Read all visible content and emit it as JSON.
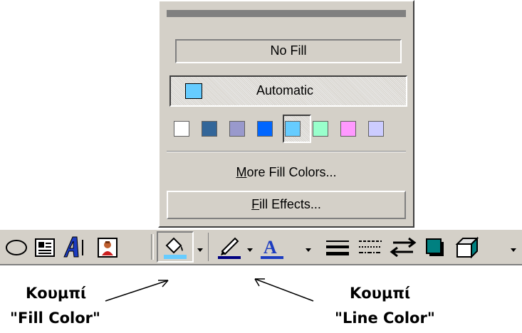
{
  "panel": {
    "no_fill_label": "No Fill",
    "automatic_label": "Automatic",
    "automatic_color": "#66ccff",
    "swatches": [
      "#ffffff",
      "#336699",
      "#9999cc",
      "#0066ff",
      "#66ccff",
      "#99ffcc",
      "#ff99ff",
      "#ccccff"
    ],
    "selected_swatch_index": 4,
    "more_colors": {
      "mnemonic": "M",
      "rest": "ore Fill Colors..."
    },
    "fill_effects": {
      "mnemonic": "F",
      "rest": "ill Effects..."
    }
  },
  "toolbar": {
    "buttons": [
      "oval-icon",
      "text-box-icon",
      "wordart-icon",
      "clip-art-icon",
      "fill-color-icon",
      "line-color-icon",
      "font-color-icon",
      "line-style-icon",
      "dash-style-icon",
      "arrow-style-icon",
      "shadow-icon",
      "3d-icon"
    ],
    "accent_fill": "#66ccff",
    "accent_line": "#000080"
  },
  "annotations": {
    "fill_line1": "Κουμπί",
    "fill_line2": "\"Fill Color\"",
    "line_line1": "Κουμπί",
    "line_line2": "\"Line Color\""
  }
}
